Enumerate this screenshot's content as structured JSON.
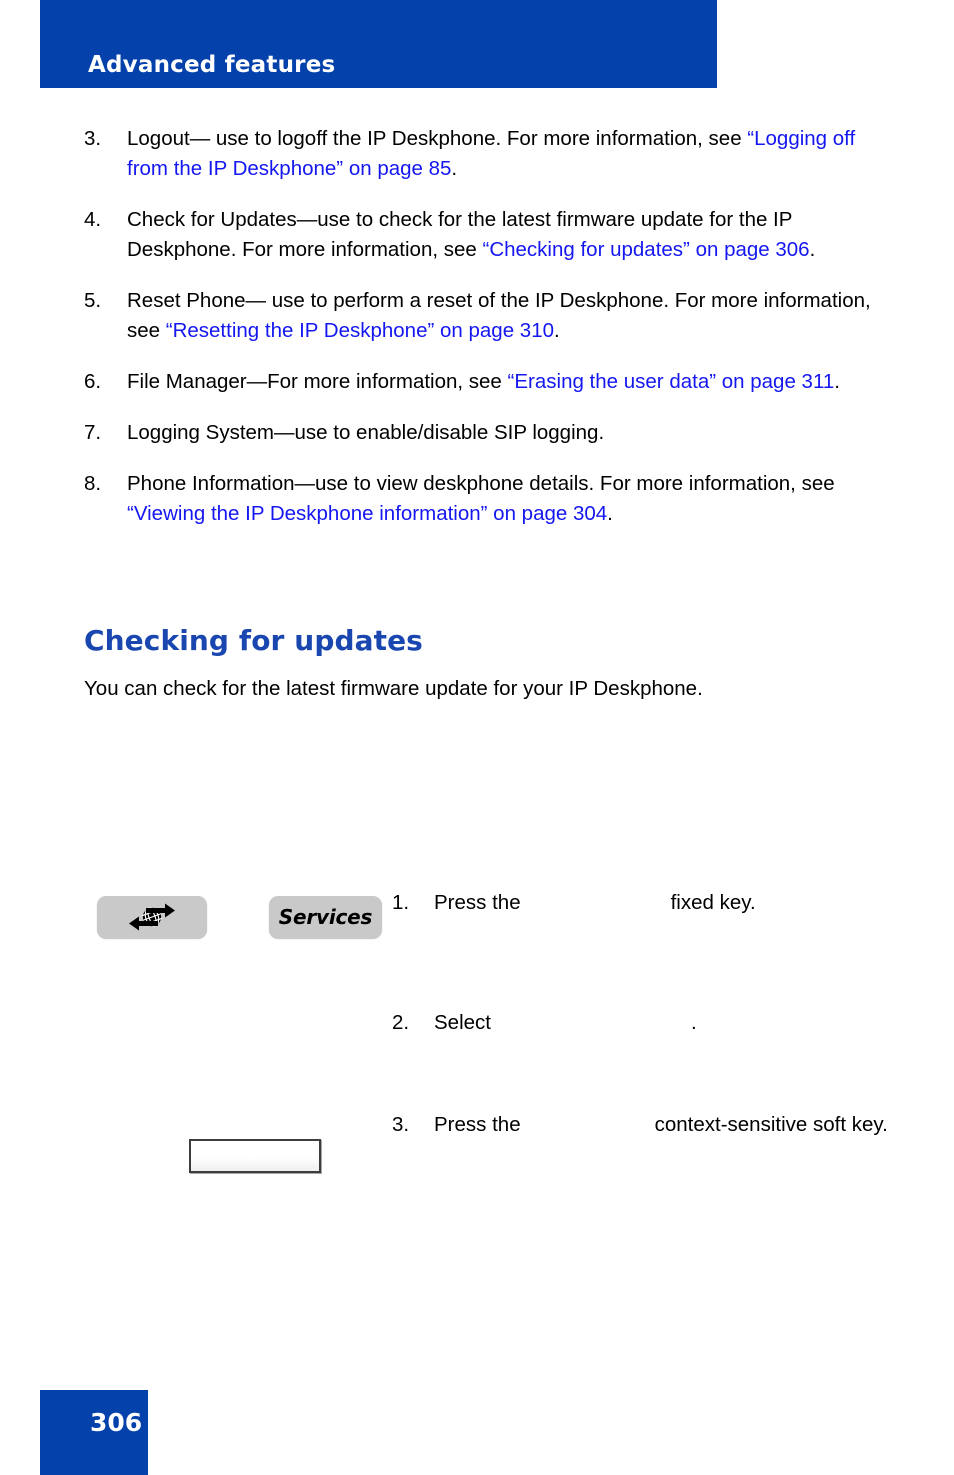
{
  "header": {
    "title": "Advanced features"
  },
  "list": {
    "items": [
      {
        "number": "3.",
        "parts": [
          {
            "text": "Logout— use to logoff the IP Deskphone. For more information, see ",
            "link": false
          },
          {
            "text": "“Logging off from the IP Deskphone” on page 85",
            "link": true
          },
          {
            "text": ".",
            "link": false
          }
        ]
      },
      {
        "number": "4.",
        "parts": [
          {
            "text": "Check for Updates—use to check for the latest firmware update for the IP Deskphone. For more information, see ",
            "link": false
          },
          {
            "text": "“Checking for updates” on page 306",
            "link": true
          },
          {
            "text": ".",
            "link": false
          }
        ]
      },
      {
        "number": "5.",
        "parts": [
          {
            "text": "Reset Phone— use to perform a reset of the IP Deskphone. For more information, see ",
            "link": false
          },
          {
            "text": "“Resetting the IP Deskphone” on page 310",
            "link": true
          },
          {
            "text": ".",
            "link": false
          }
        ]
      },
      {
        "number": "6.",
        "parts": [
          {
            "text": "File Manager—For more information, see ",
            "link": false
          },
          {
            "text": "“Erasing the user data” on page 311",
            "link": true
          },
          {
            "text": ".",
            "link": false
          }
        ]
      },
      {
        "number": "7.",
        "parts": [
          {
            "text": "Logging System—use to enable/disable SIP logging.",
            "link": false
          }
        ]
      },
      {
        "number": "8.",
        "parts": [
          {
            "text": "Phone Information—use to view deskphone details. For more information, see ",
            "link": false
          },
          {
            "text": "“Viewing the IP Deskphone information” on page 304",
            "link": true
          },
          {
            "text": ".",
            "link": false
          }
        ]
      }
    ]
  },
  "section": {
    "heading": "Checking for updates",
    "intro": "You can check for the latest firmware update for your IP Deskphone."
  },
  "procedure": {
    "steps": [
      {
        "number": "1.",
        "before": "Press the",
        "after": "fixed key."
      },
      {
        "number": "2.",
        "before": "Select",
        "after": "."
      },
      {
        "number": "3.",
        "before": "Press the",
        "after": "context-sensitive soft key."
      }
    ],
    "art": {
      "globe_key_icon": "globe-arrows-key-icon",
      "services_key_label": "Services",
      "soft_key_label": ""
    }
  },
  "footer": {
    "page_number": "306"
  },
  "colors": {
    "brand_blue": "#0541ab",
    "heading_blue": "#1a46b0",
    "link_blue": "#1417f0",
    "key_gray": "#c9c9c9"
  }
}
